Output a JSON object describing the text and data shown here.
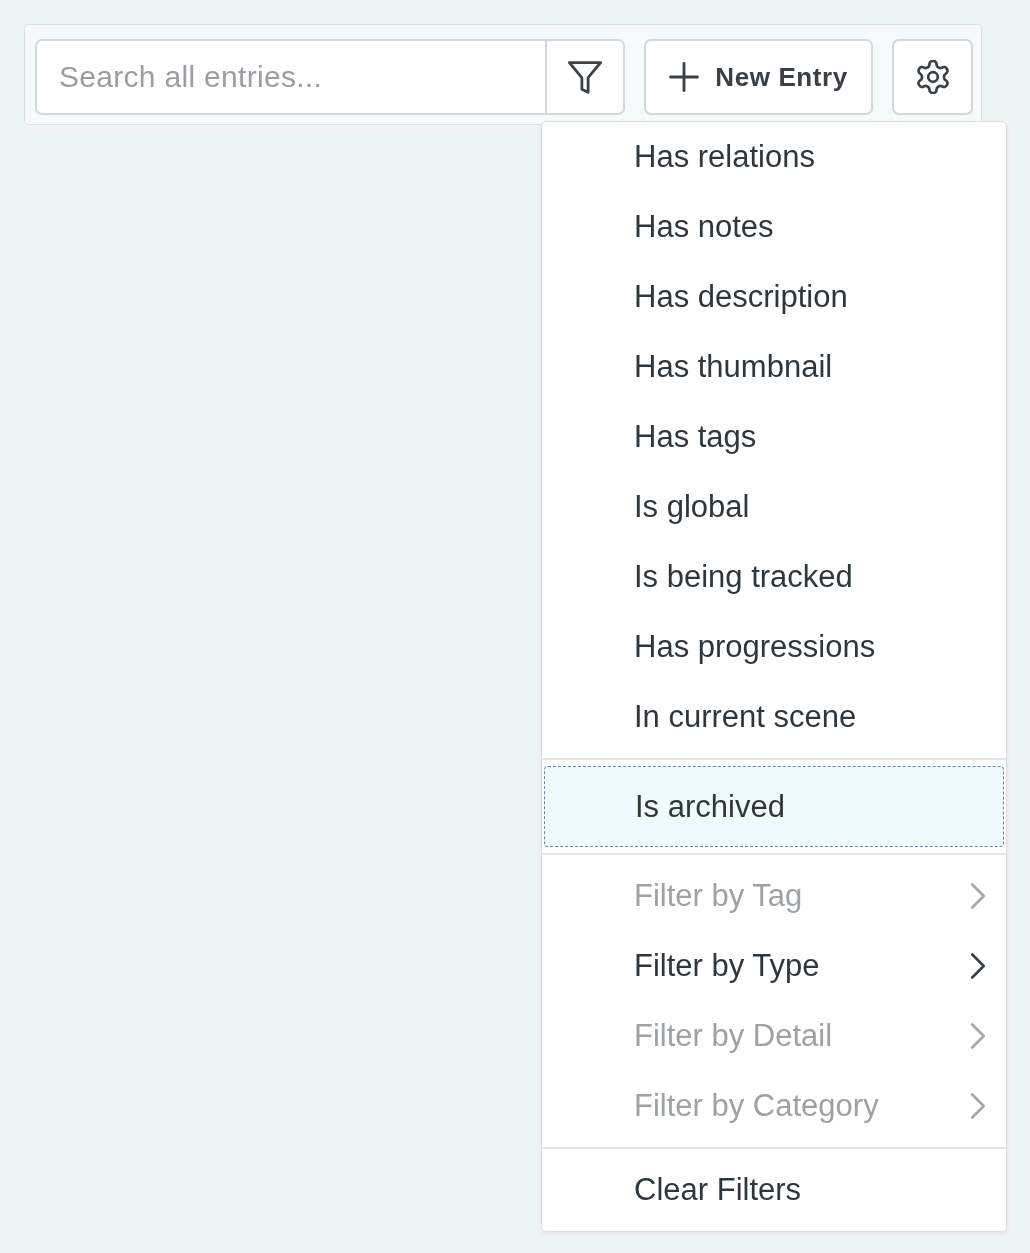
{
  "toolbar": {
    "search": {
      "placeholder": "Search all entries..."
    },
    "new_entry_button": {
      "label": "New Entry"
    }
  },
  "filter_menu": {
    "sections": [
      {
        "items": [
          {
            "label": "Has relations",
            "kind": "option",
            "selected": false,
            "disabled": false
          },
          {
            "label": "Has notes",
            "kind": "option",
            "selected": false,
            "disabled": false
          },
          {
            "label": "Has description",
            "kind": "option",
            "selected": false,
            "disabled": false
          },
          {
            "label": "Has thumbnail",
            "kind": "option",
            "selected": false,
            "disabled": false
          },
          {
            "label": "Has tags",
            "kind": "option",
            "selected": false,
            "disabled": false
          },
          {
            "label": "Is global",
            "kind": "option",
            "selected": false,
            "disabled": false
          },
          {
            "label": "Is being tracked",
            "kind": "option",
            "selected": false,
            "disabled": false
          },
          {
            "label": "Has progressions",
            "kind": "option",
            "selected": false,
            "disabled": false
          },
          {
            "label": "In current scene",
            "kind": "option",
            "selected": false,
            "disabled": false
          }
        ]
      },
      {
        "items": [
          {
            "label": "Is archived",
            "kind": "option",
            "selected": true,
            "disabled": false
          }
        ]
      },
      {
        "items": [
          {
            "label": "Filter by Tag",
            "kind": "submenu",
            "selected": false,
            "disabled": true
          },
          {
            "label": "Filter by Type",
            "kind": "submenu",
            "selected": false,
            "disabled": false
          },
          {
            "label": "Filter by Detail",
            "kind": "submenu",
            "selected": false,
            "disabled": true
          },
          {
            "label": "Filter by Category",
            "kind": "submenu",
            "selected": false,
            "disabled": true
          }
        ]
      },
      {
        "items": [
          {
            "label": "Clear Filters",
            "kind": "option",
            "selected": false,
            "disabled": false
          }
        ]
      }
    ]
  }
}
